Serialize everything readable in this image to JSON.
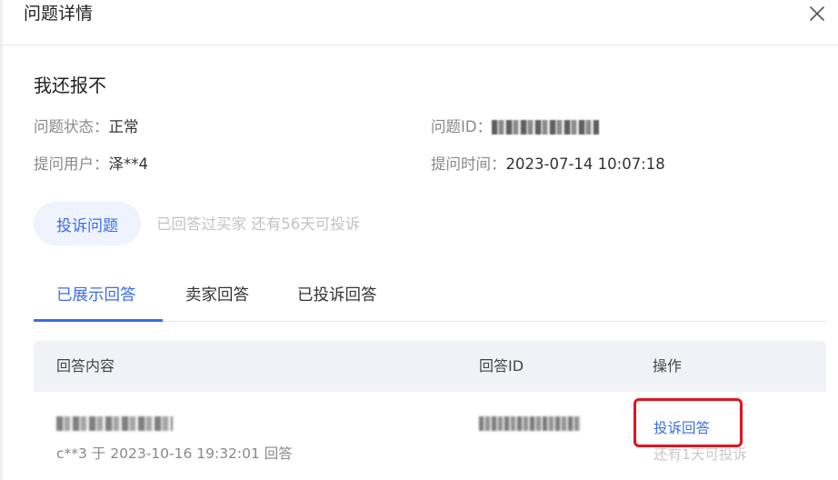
{
  "dialog": {
    "title": "问题详情",
    "close_icon": "close-icon"
  },
  "question": {
    "title": "我还报不",
    "status_label": "问题状态：",
    "status_value": "正常",
    "id_label": "问题ID：",
    "user_label": "提问用户：",
    "user_value": "泽**4",
    "time_label": "提问时间：",
    "time_value": "2023-07-14 10:07:18"
  },
  "complaint": {
    "button_label": "投诉问题",
    "note": "已回答过买家 还有56天可投诉"
  },
  "tabs": [
    {
      "label": "已展示回答",
      "active": true
    },
    {
      "label": "卖家回答",
      "active": false
    },
    {
      "label": "已投诉回答",
      "active": false
    }
  ],
  "table": {
    "headers": [
      "回答内容",
      "回答ID",
      "操作"
    ],
    "rows": [
      {
        "meta": "c**3 于 2023-10-16 19:32:01 回答",
        "action_label": "投诉回答",
        "action_note": "还有1天可投诉"
      }
    ]
  },
  "colors": {
    "accent": "#3b6ee8",
    "highlight_box": "#e0141e",
    "muted": "#c2c2c2"
  }
}
